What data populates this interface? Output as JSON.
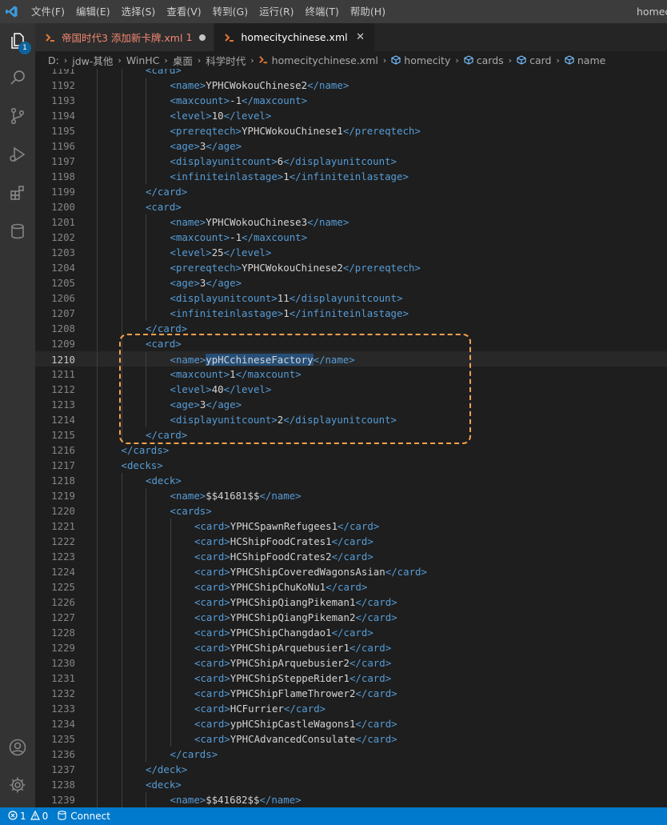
{
  "titlebar": {
    "menu": [
      "文件(F)",
      "编辑(E)",
      "选择(S)",
      "查看(V)",
      "转到(G)",
      "运行(R)",
      "终端(T)",
      "帮助(H)"
    ],
    "window_title": "homec"
  },
  "activity": {
    "explorer_badge": "1"
  },
  "tabs": [
    {
      "label": "帝国时代3 添加新卡牌.xml",
      "count": "1",
      "state": "modified"
    },
    {
      "label": "homecitychinese.xml",
      "state": "active"
    }
  ],
  "breadcrumb": [
    "D:",
    "jdw-其他",
    "WinHC",
    "桌面",
    "科学时代",
    "homecitychinese.xml",
    "homecity",
    "cards",
    "card",
    "name"
  ],
  "editor": {
    "current_line": "1210",
    "selected_text": "ypHCchineseFactory",
    "lines": [
      {
        "n": "1191",
        "indent": 2,
        "t": "<card>"
      },
      {
        "n": "1192",
        "indent": 3,
        "t": "<name>",
        "v": "YPHCWokouChinese2",
        "c": "</name>"
      },
      {
        "n": "1193",
        "indent": 3,
        "t": "<maxcount>",
        "v": "-1",
        "c": "</maxcount>"
      },
      {
        "n": "1194",
        "indent": 3,
        "t": "<level>",
        "v": "10",
        "c": "</level>"
      },
      {
        "n": "1195",
        "indent": 3,
        "t": "<prereqtech>",
        "v": "YPHCWokouChinese1",
        "c": "</prereqtech>"
      },
      {
        "n": "1196",
        "indent": 3,
        "t": "<age>",
        "v": "3",
        "c": "</age>"
      },
      {
        "n": "1197",
        "indent": 3,
        "t": "<displayunitcount>",
        "v": "6",
        "c": "</displayunitcount>"
      },
      {
        "n": "1198",
        "indent": 3,
        "t": "<infiniteinlastage>",
        "v": "1",
        "c": "</infiniteinlastage>"
      },
      {
        "n": "1199",
        "indent": 2,
        "t": "</card>"
      },
      {
        "n": "1200",
        "indent": 2,
        "t": "<card>"
      },
      {
        "n": "1201",
        "indent": 3,
        "t": "<name>",
        "v": "YPHCWokouChinese3",
        "c": "</name>"
      },
      {
        "n": "1202",
        "indent": 3,
        "t": "<maxcount>",
        "v": "-1",
        "c": "</maxcount>"
      },
      {
        "n": "1203",
        "indent": 3,
        "t": "<level>",
        "v": "25",
        "c": "</level>"
      },
      {
        "n": "1204",
        "indent": 3,
        "t": "<prereqtech>",
        "v": "YPHCWokouChinese2",
        "c": "</prereqtech>"
      },
      {
        "n": "1205",
        "indent": 3,
        "t": "<age>",
        "v": "3",
        "c": "</age>"
      },
      {
        "n": "1206",
        "indent": 3,
        "t": "<displayunitcount>",
        "v": "11",
        "c": "</displayunitcount>"
      },
      {
        "n": "1207",
        "indent": 3,
        "t": "<infiniteinlastage>",
        "v": "1",
        "c": "</infiniteinlastage>"
      },
      {
        "n": "1208",
        "indent": 2,
        "t": "</card>"
      },
      {
        "n": "1209",
        "indent": 2,
        "t": "<card>"
      },
      {
        "n": "1210",
        "indent": 3,
        "t": "<name>",
        "v": "ypHCchineseFactory",
        "c": "</name>",
        "selected": true
      },
      {
        "n": "1211",
        "indent": 3,
        "t": "<maxcount>",
        "v": "1",
        "c": "</maxcount>"
      },
      {
        "n": "1212",
        "indent": 3,
        "t": "<level>",
        "v": "40",
        "c": "</level>"
      },
      {
        "n": "1213",
        "indent": 3,
        "t": "<age>",
        "v": "3",
        "c": "</age>"
      },
      {
        "n": "1214",
        "indent": 3,
        "t": "<displayunitcount>",
        "v": "2",
        "c": "</displayunitcount>"
      },
      {
        "n": "1215",
        "indent": 2,
        "t": "</card>"
      },
      {
        "n": "1216",
        "indent": 1,
        "t": "</cards>"
      },
      {
        "n": "1217",
        "indent": 1,
        "t": "<decks>"
      },
      {
        "n": "1218",
        "indent": 2,
        "t": "<deck>"
      },
      {
        "n": "1219",
        "indent": 3,
        "t": "<name>",
        "v": "$$41681$$",
        "c": "</name>"
      },
      {
        "n": "1220",
        "indent": 3,
        "t": "<cards>"
      },
      {
        "n": "1221",
        "indent": 4,
        "t": "<card>",
        "v": "YPHCSpawnRefugees1",
        "c": "</card>"
      },
      {
        "n": "1222",
        "indent": 4,
        "t": "<card>",
        "v": "HCShipFoodCrates1",
        "c": "</card>"
      },
      {
        "n": "1223",
        "indent": 4,
        "t": "<card>",
        "v": "HCShipFoodCrates2",
        "c": "</card>"
      },
      {
        "n": "1224",
        "indent": 4,
        "t": "<card>",
        "v": "YPHCShipCoveredWagonsAsian",
        "c": "</card>"
      },
      {
        "n": "1225",
        "indent": 4,
        "t": "<card>",
        "v": "YPHCShipChuKoNu1",
        "c": "</card>"
      },
      {
        "n": "1226",
        "indent": 4,
        "t": "<card>",
        "v": "YPHCShipQiangPikeman1",
        "c": "</card>"
      },
      {
        "n": "1227",
        "indent": 4,
        "t": "<card>",
        "v": "YPHCShipQiangPikeman2",
        "c": "</card>"
      },
      {
        "n": "1228",
        "indent": 4,
        "t": "<card>",
        "v": "YPHCShipChangdao1",
        "c": "</card>"
      },
      {
        "n": "1229",
        "indent": 4,
        "t": "<card>",
        "v": "YPHCShipArquebusier1",
        "c": "</card>"
      },
      {
        "n": "1230",
        "indent": 4,
        "t": "<card>",
        "v": "YPHCShipArquebusier2",
        "c": "</card>"
      },
      {
        "n": "1231",
        "indent": 4,
        "t": "<card>",
        "v": "YPHCShipSteppeRider1",
        "c": "</card>"
      },
      {
        "n": "1232",
        "indent": 4,
        "t": "<card>",
        "v": "YPHCShipFlameThrower2",
        "c": "</card>"
      },
      {
        "n": "1233",
        "indent": 4,
        "t": "<card>",
        "v": "HCFurrier",
        "c": "</card>"
      },
      {
        "n": "1234",
        "indent": 4,
        "t": "<card>",
        "v": "ypHCShipCastleWagons1",
        "c": "</card>"
      },
      {
        "n": "1235",
        "indent": 4,
        "t": "<card>",
        "v": "YPHCAdvancedConsulate",
        "c": "</card>"
      },
      {
        "n": "1236",
        "indent": 3,
        "t": "</cards>"
      },
      {
        "n": "1237",
        "indent": 2,
        "t": "</deck>"
      },
      {
        "n": "1238",
        "indent": 2,
        "t": "<deck>"
      },
      {
        "n": "1239",
        "indent": 3,
        "t": "<name>",
        "v": "$$41682$$",
        "c": "</name>"
      }
    ]
  },
  "statusbar": {
    "errors": "1",
    "warnings": "0",
    "connect_label": "Connect"
  },
  "colors": {
    "accent": "#007acc",
    "tag": "#569cd6",
    "text": "#d4d4d4",
    "highlight_box": "#f5a34d"
  },
  "icons": [
    "vscode-logo-icon",
    "files-icon",
    "search-icon",
    "source-control-icon",
    "run-debug-icon",
    "extensions-icon",
    "database-icon",
    "account-icon",
    "settings-gear-icon",
    "xml-file-icon",
    "symbol-icon",
    "error-icon",
    "warning-icon",
    "database-small-icon"
  ]
}
